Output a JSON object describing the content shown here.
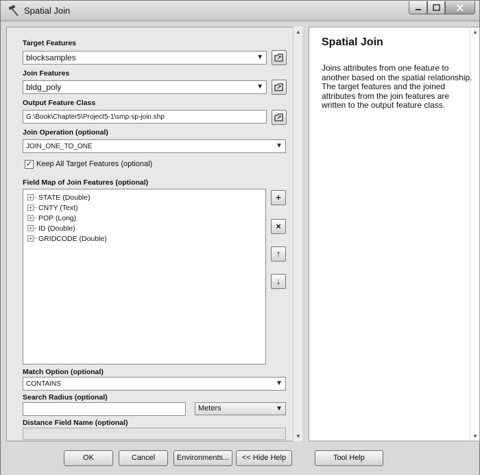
{
  "window": {
    "title": "Spatial Join",
    "icon": "hammer-icon"
  },
  "form": {
    "target_features": {
      "label": "Target Features",
      "value": "blocksamples"
    },
    "join_features": {
      "label": "Join Features",
      "value": "bldg_poly"
    },
    "output_feature_class": {
      "label": "Output Feature Class",
      "value": "G:\\Book\\Chapter5\\Project5-1\\smp-sp-join.shp"
    },
    "join_operation": {
      "label": "Join Operation (optional)",
      "value": "JOIN_ONE_TO_ONE"
    },
    "keep_all": {
      "label": "Keep All Target Features (optional)",
      "checked": true,
      "mark": "✓"
    },
    "field_map": {
      "label": "Field Map of Join Features (optional)",
      "items": [
        "STATE (Double)",
        "CNTY (Text)",
        "POP (Long)",
        "ID (Double)",
        "GRIDCODE (Double)"
      ],
      "expand_glyph": "+"
    },
    "side_buttons": {
      "add": "+",
      "remove": "×",
      "up": "↑",
      "down": "↓"
    },
    "match_option": {
      "label": "Match Option (optional)",
      "value": "CONTAINS"
    },
    "search_radius": {
      "label": "Search Radius (optional)",
      "value": "",
      "unit": "Meters"
    },
    "distance_field": {
      "label": "Distance Field Name (optional)",
      "value": ""
    }
  },
  "help": {
    "title": "Spatial Join",
    "text": "Joins attributes from one feature to another based on the spatial relationship. The target features and the joined attributes from the join features are written to the output feature class."
  },
  "buttons": {
    "ok": "OK",
    "cancel": "Cancel",
    "environments": "Environments...",
    "hide_help": "<< Hide Help",
    "tool_help": "Tool Help"
  },
  "glyphs": {
    "dropdown": "▼",
    "scroll_up": "▲",
    "scroll_down": "▼"
  }
}
